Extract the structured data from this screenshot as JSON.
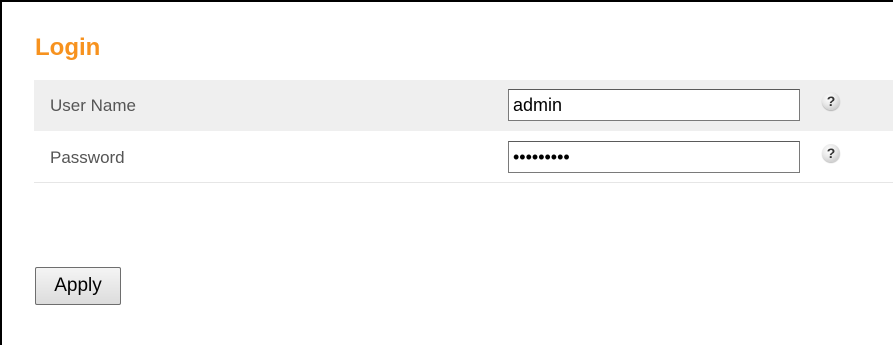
{
  "page": {
    "title": "Login"
  },
  "form": {
    "username": {
      "label": "User Name",
      "value": "admin",
      "help_icon": "question-mark-icon"
    },
    "password": {
      "label": "Password",
      "value": "•••••••••",
      "help_icon": "question-mark-icon"
    }
  },
  "actions": {
    "apply_label": "Apply"
  },
  "colors": {
    "title": "#f7921e",
    "row_highlight": "#efefef",
    "label_text": "#555555"
  },
  "icons": {
    "help_glyph": "?"
  }
}
